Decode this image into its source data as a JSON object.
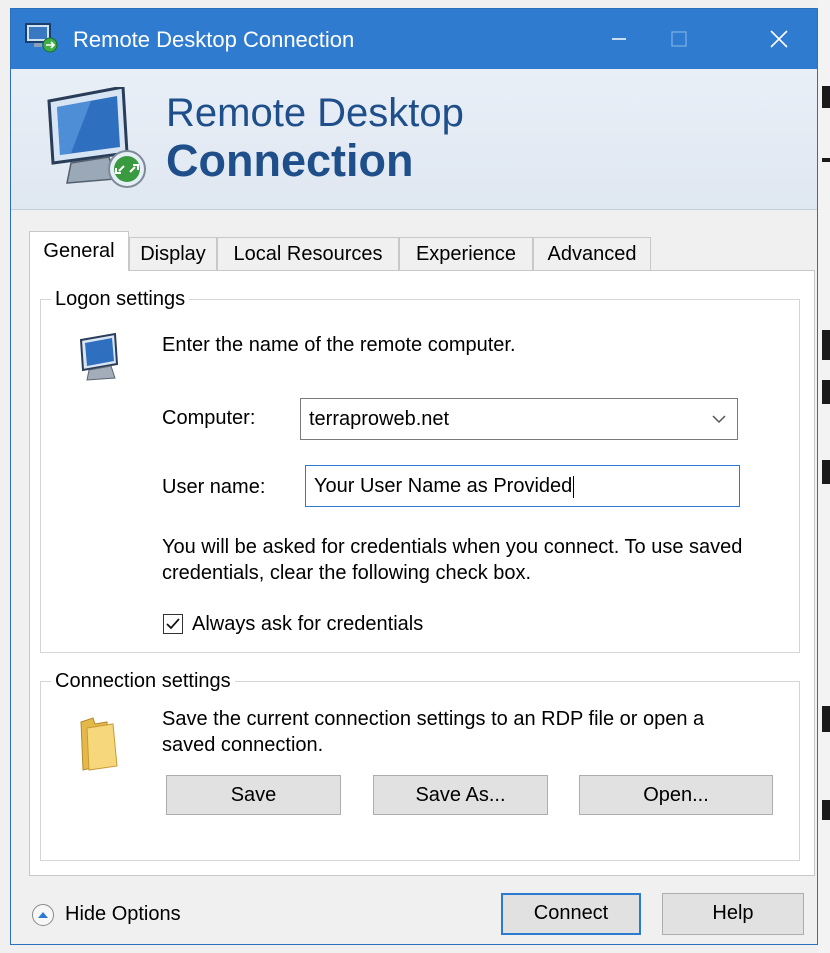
{
  "window": {
    "title": "Remote Desktop Connection",
    "controls": {
      "minimize": "minimize-icon",
      "maximize": "maximize-icon",
      "close": "close-icon"
    }
  },
  "banner": {
    "line1": "Remote Desktop",
    "line2": "Connection"
  },
  "tabs": [
    {
      "label": "General",
      "active": true
    },
    {
      "label": "Display",
      "active": false
    },
    {
      "label": "Local Resources",
      "active": false
    },
    {
      "label": "Experience",
      "active": false
    },
    {
      "label": "Advanced",
      "active": false
    }
  ],
  "logon": {
    "legend": "Logon settings",
    "intro": "Enter the name of the remote computer.",
    "computer_label": "Computer:",
    "computer_value": "terraproweb.net",
    "username_label": "User name:",
    "username_value": "Your User Name as Provided",
    "info": "You will be asked for credentials when you connect. To use saved credentials, clear the following check box.",
    "always_ask_label": "Always ask for credentials",
    "always_ask_checked": true
  },
  "connection": {
    "legend": "Connection settings",
    "info": "Save the current connection settings to an RDP file or open a saved connection.",
    "save_label": "Save",
    "save_as_label": "Save As...",
    "open_label": "Open..."
  },
  "footer": {
    "hide_options_label": "Hide Options",
    "connect_label": "Connect",
    "help_label": "Help"
  },
  "colors": {
    "titlebar": "#2f7bd0",
    "banner_text": "#1f4f8a",
    "focus_border": "#2e7ad1"
  }
}
